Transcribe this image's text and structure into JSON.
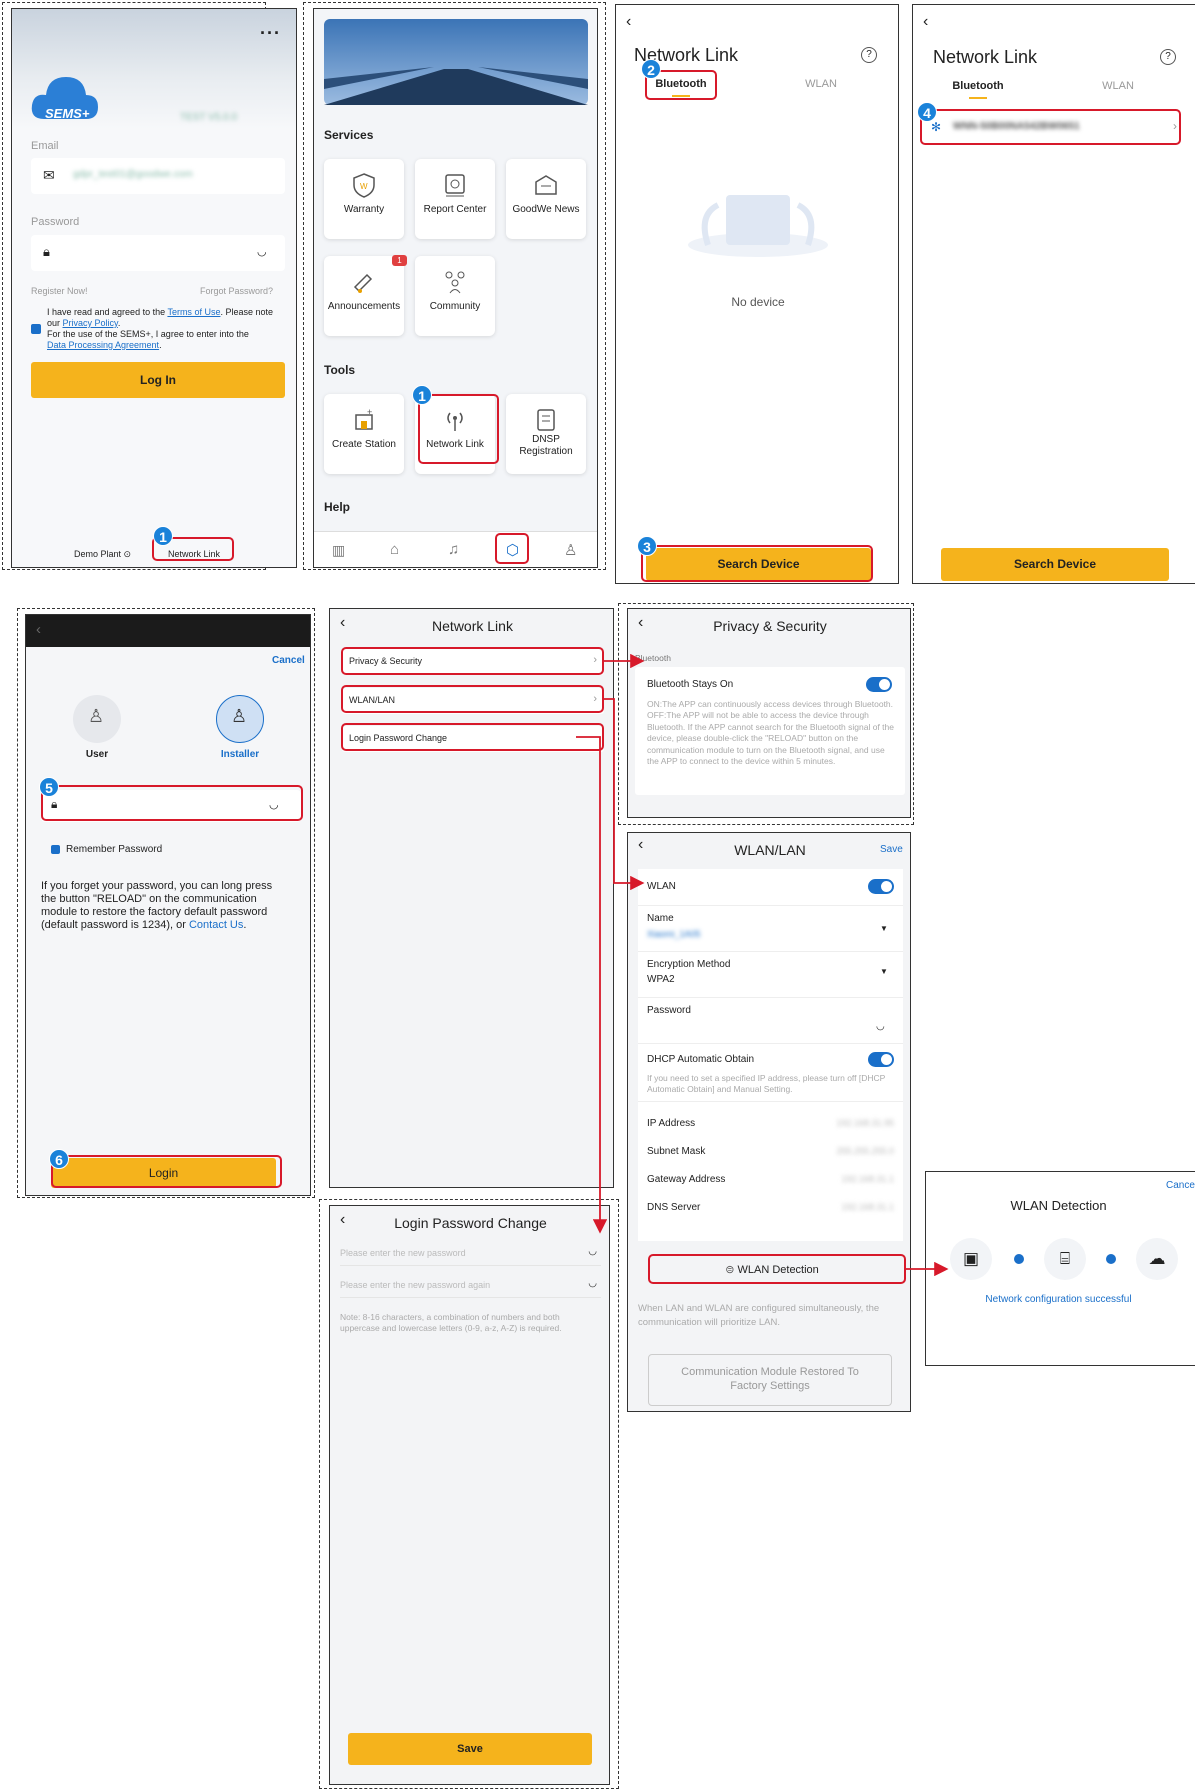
{
  "login": {
    "email_label": "Email",
    "email_value": "gdpr_test01@goodwe.com",
    "password_label": "Password",
    "register": "Register Now!",
    "forgot": "Forgot Password?",
    "brand": "SEMS+",
    "version": "TEST V5.0.0",
    "consent_1": "I have read and agreed to the ",
    "terms": "Terms of Use",
    "consent_2": ". Please note our ",
    "privacy": "Privacy Policy",
    "consent_3": ".",
    "consent_4": "For the use of the SEMS+, I agree to enter into the",
    "dpa": "Data Processing Agreement",
    "consent_5": ".",
    "login_btn": "Log In",
    "demo": "Demo Plant",
    "network_link": "Network Link",
    "menu_icon": "more-dots-icon"
  },
  "services": {
    "section": "Services",
    "items": [
      "Warranty",
      "Report Center",
      "GoodWe News",
      "Announcements",
      "Community"
    ],
    "announce_badge": "1",
    "tools": "Tools",
    "tool_items": [
      "Create Station",
      "Network Link",
      "DNSP Registration"
    ],
    "help": "Help",
    "tabs": [
      "chart-icon",
      "home-icon",
      "bell-icon",
      "box-icon",
      "user-icon"
    ]
  },
  "nl_empty": {
    "title": "Network Link",
    "tab_bt": "Bluetooth",
    "tab_wlan": "WLAN",
    "empty": "No device",
    "search": "Search Device"
  },
  "nl_found": {
    "title": "Network Link",
    "tab_bt": "Bluetooth",
    "tab_wlan": "WLAN",
    "device": "WNN-50B00NA542BW0651",
    "search": "Search Device"
  },
  "login2": {
    "cancel": "Cancel",
    "user": "User",
    "installer": "Installer",
    "remember": "Remember Password",
    "note_1": "If you forget your password, you can long press the button \"RELOAD\" on the communication module to restore the factory default password (default password is 1234), or ",
    "contact": "Contact Us",
    "note_2": ".",
    "login": "Login"
  },
  "nl_menu": {
    "title": "Network Link",
    "items": [
      "Privacy & Security",
      "WLAN/LAN",
      "Login Password Change"
    ]
  },
  "privacy": {
    "title": "Privacy & Security",
    "section": "Bluetooth",
    "toggle_label": "Bluetooth Stays On",
    "desc": "ON:The APP can continuously access devices through Bluetooth. OFF:The APP will not be able to access the device through Bluetooth. If the APP cannot search for the Bluetooth signal of the device, please double-click the \"RELOAD\" button on the communication module to turn on the Bluetooth signal, and use the APP to connect to the device within 5 minutes."
  },
  "wlan": {
    "title": "WLAN/LAN",
    "save": "Save",
    "wlan": "WLAN",
    "name_label": "Name",
    "name_value": "Xiaomi_1A05",
    "enc_label": "Encryption Method",
    "enc_value": "WPA2",
    "pwd_label": "Password",
    "dhcp": "DHCP Automatic Obtain",
    "dhcp_note": "If you need to set a specified IP address, please turn off [DHCP Automatic Obtain] and Manual Setting.",
    "ip_label": "IP Address",
    "ip": "192.168.31.95",
    "mask_label": "Subnet Mask",
    "mask": "255.255.255.0",
    "gw_label": "Gateway Address",
    "gw": "192.168.31.1",
    "dns_label": "DNS Server",
    "dns": "192.168.31.1",
    "detect": "WLAN Detection",
    "lan_note": "When LAN and WLAN are configured simultaneously, the communication will prioritize LAN.",
    "restore": "Communication Module Restored To Factory Settings"
  },
  "pwdchange": {
    "title": "Login Password Change",
    "ph1": "Please enter the new password",
    "ph2": "Please enter the new password again",
    "note": "Note: 8-16 characters, a combination of numbers and both uppercase and lowercase letters (0-9, a-z, A-Z) is required.",
    "save": "Save"
  },
  "detect": {
    "cancel": "Cance",
    "title": "WLAN Detection",
    "result": "Network configuration successful"
  },
  "badges": {
    "b1": "1",
    "b2": "2",
    "b3": "3",
    "b4": "4",
    "b5": "5",
    "b6": "6"
  },
  "colors": {
    "accent": "#f5b31c",
    "highlight": "#d7192a",
    "blue": "#1a6fc9",
    "badge": "#1a82d9"
  }
}
